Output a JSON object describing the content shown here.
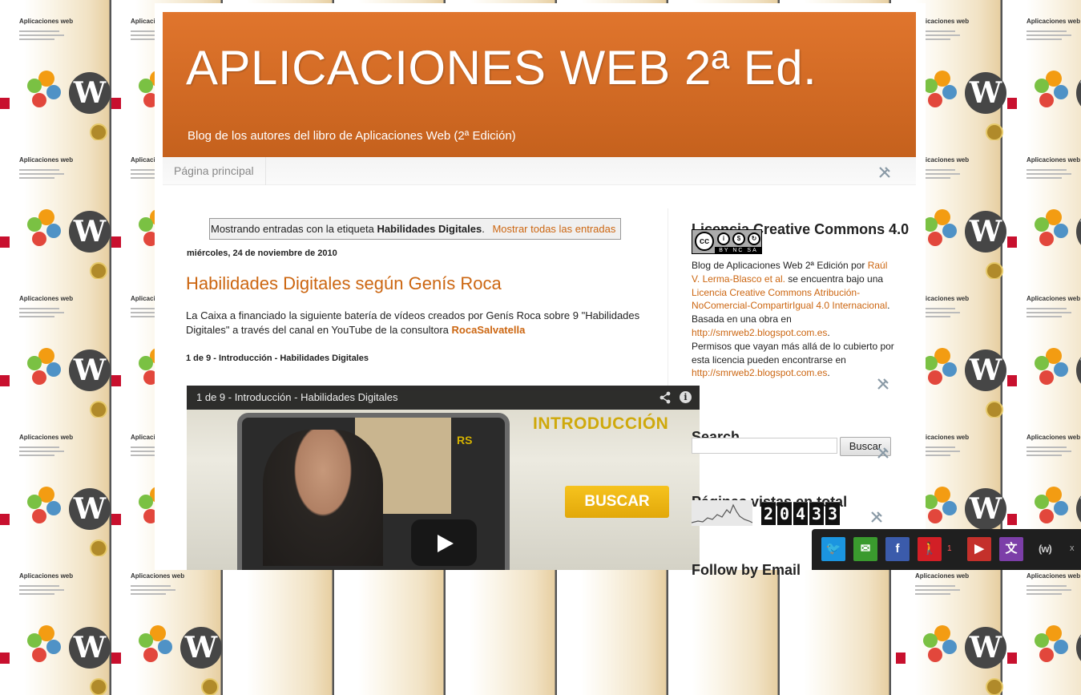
{
  "tile": {
    "title": "Aplicaciones web"
  },
  "blog": {
    "title": "APLICACIONES WEB 2ª Ed.",
    "description": "Blog de los autores del libro de Aplicaciones Web (2ª Edición)"
  },
  "nav": {
    "tabs": [
      "Página principal"
    ]
  },
  "label_filter": {
    "prefix": "Mostrando entradas con la etiqueta",
    "label": "Habilidades Digitales",
    "suffix": ".",
    "show_all": "Mostrar todas las entradas"
  },
  "post": {
    "date": "miércoles, 24 de noviembre de 2010",
    "title": "Habilidades Digitales según Genís Roca",
    "body_text": "La Caixa a financiado la siguiente batería de vídeos creados por Genís Roca sobre 9 \"Habilidades Digitales\" a través del canal en YouTube de la consultora",
    "body_link": "RocaSalvatella",
    "video_heading": "1 de 9 - Introducción - Habilidades Digitales",
    "video": {
      "title": "1 de 9 - Introducción - Habilidades Digitales",
      "overlay_title": "INTRODUCCIÓN",
      "overlay_button": "BUSCAR",
      "overlay_logo": "RS"
    }
  },
  "sidebar": {
    "license": {
      "heading": "Licencia Creative Commons 4.0",
      "badge_icons": [
        "cc",
        "by",
        "nc",
        "sa"
      ],
      "badge_strip": "BY NC SA",
      "line1": "Blog de Aplicaciones Web 2ª Edición por",
      "author_link": "Raúl V. Lerma-Blasco et al.",
      "line2": "se encuentra bajo una",
      "license_link": "Licencia Creative Commons Atribución-NoComercial-CompartirIgual 4.0 Internacional",
      "line3": ".",
      "based_on": "Basada en una obra en",
      "based_link": "http://smrweb2.blogspot.com.es",
      "permissions": "Permisos que vayan más allá de lo cubierto por esta licencia pueden encontrarse en",
      "permissions_link": "http://smrweb2.blogspot.com.es"
    },
    "search": {
      "heading": "Search",
      "button": "Buscar",
      "value": ""
    },
    "pageviews": {
      "heading": "Páginas vistas en total",
      "digits": [
        "2",
        "0",
        "4",
        "3",
        "3"
      ]
    },
    "follow": {
      "heading": "Follow by Email"
    }
  },
  "social_bar": {
    "buttons": [
      {
        "name": "twitter-icon",
        "glyph": "🐦",
        "color": "#1b95e0"
      },
      {
        "name": "email-icon",
        "glyph": "✉",
        "color": "#3a9a2e"
      },
      {
        "name": "facebook-icon",
        "glyph": "f",
        "color": "#3b5bab"
      },
      {
        "name": "pedestrian-icon",
        "glyph": "🚶",
        "color": "#d21f26"
      },
      {
        "name": "youtube-icon",
        "glyph": "▶",
        "color": "#c4302b"
      },
      {
        "name": "translate-icon",
        "glyph": "文",
        "color": "#7c3ea8"
      }
    ],
    "badge_count": "1",
    "brand": "(w)",
    "close": "x"
  },
  "colors": {
    "header_orange": "#d46a24",
    "link_orange": "#cc6611"
  }
}
